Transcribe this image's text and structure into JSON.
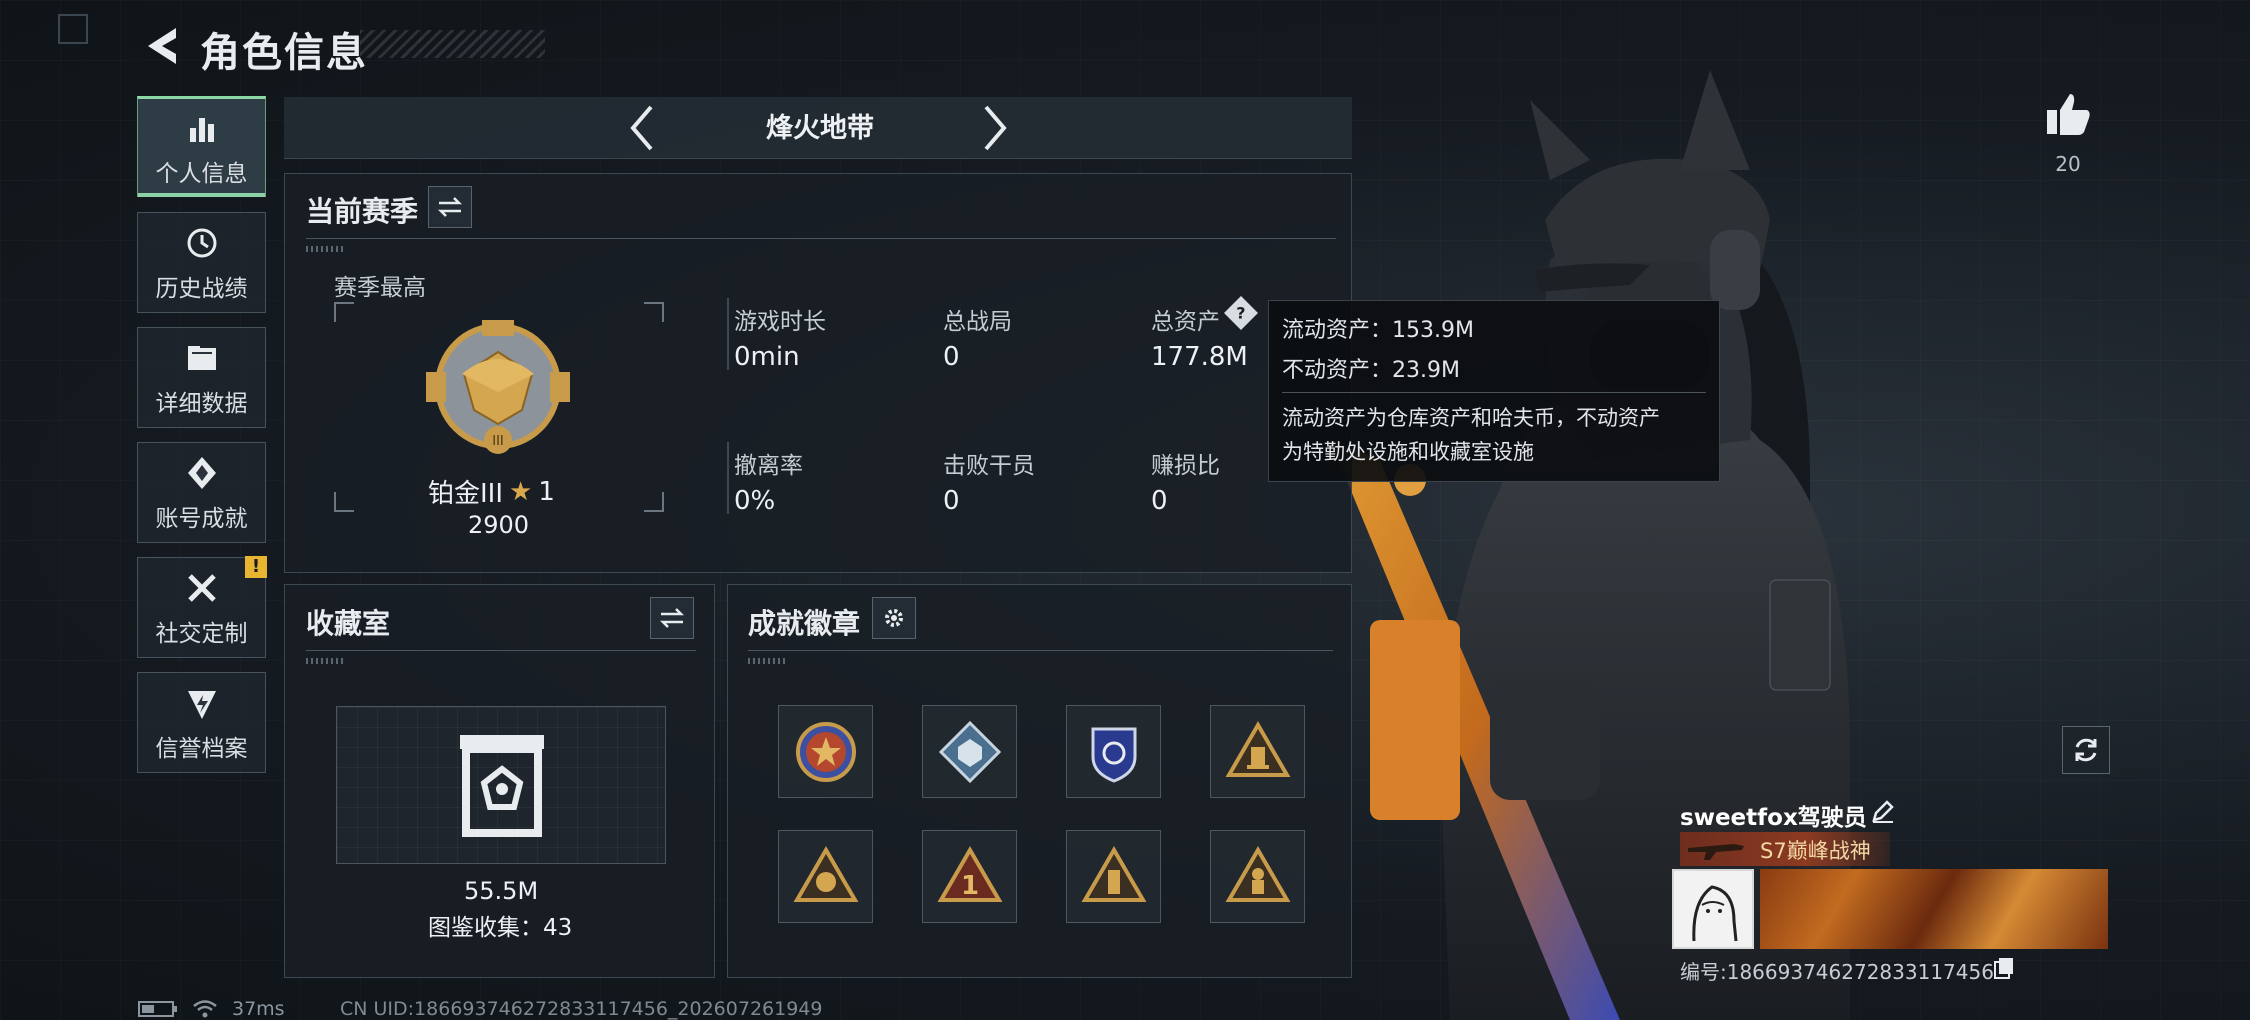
{
  "header": {
    "title": "角色信息"
  },
  "nav": {
    "items": [
      {
        "label": "个人信息",
        "icon": "bar-chart-icon",
        "active": true
      },
      {
        "label": "历史战绩",
        "icon": "history-clock-icon",
        "active": false
      },
      {
        "label": "详细数据",
        "icon": "folder-icon",
        "active": false
      },
      {
        "label": "账号成就",
        "icon": "achievement-diamond-icon",
        "active": false
      },
      {
        "label": "社交定制",
        "icon": "wrench-screwdriver-icon",
        "active": false,
        "badge": "!"
      },
      {
        "label": "信誉档案",
        "icon": "shield-lightning-icon",
        "active": false
      }
    ]
  },
  "mode": {
    "title": "烽火地带"
  },
  "season": {
    "title": "当前赛季",
    "best_label": "赛季最高",
    "rank": "铂金III",
    "stars": "1",
    "score": "2900",
    "stats": [
      {
        "label": "游戏时长",
        "value": "0min"
      },
      {
        "label": "总战局",
        "value": "0"
      },
      {
        "label": "总资产",
        "value": "177.8M"
      },
      {
        "label": "撤离率",
        "value": "0%"
      },
      {
        "label": "击败干员",
        "value": "0"
      },
      {
        "label": "赚损比",
        "value": "0"
      }
    ]
  },
  "tooltip": {
    "line1": "流动资产：153.9M",
    "line2": "不动资产：23.9M",
    "desc1": "流动资产为仓库资产和哈夫币，不动资产",
    "desc2": "为特勤处设施和收藏室设施"
  },
  "collection": {
    "title": "收藏室",
    "value": "55.5M",
    "count_text": "图鉴收集：43"
  },
  "badges": {
    "title": "成就徽章",
    "items": [
      "star-shield-badge",
      "cube-diamond-badge",
      "police-shield-badge",
      "triangle-trophy-badge",
      "triangle-lion-badge",
      "triangle-number-one-badge",
      "triangle-tower-badge",
      "triangle-soldier-badge"
    ]
  },
  "profile": {
    "likes": "20",
    "name": "sweetfox驾驶员",
    "title": "S7巅峰战神",
    "uid_text": "编号:18669374627283311745​6"
  },
  "footer": {
    "ping": "37ms",
    "uid_line": "CN UID:186693746272833117456_202607261949"
  },
  "colors": {
    "accent_green": "#8ed0a8",
    "gold": "#c79b4a",
    "badge_yellow": "#e8b431"
  }
}
